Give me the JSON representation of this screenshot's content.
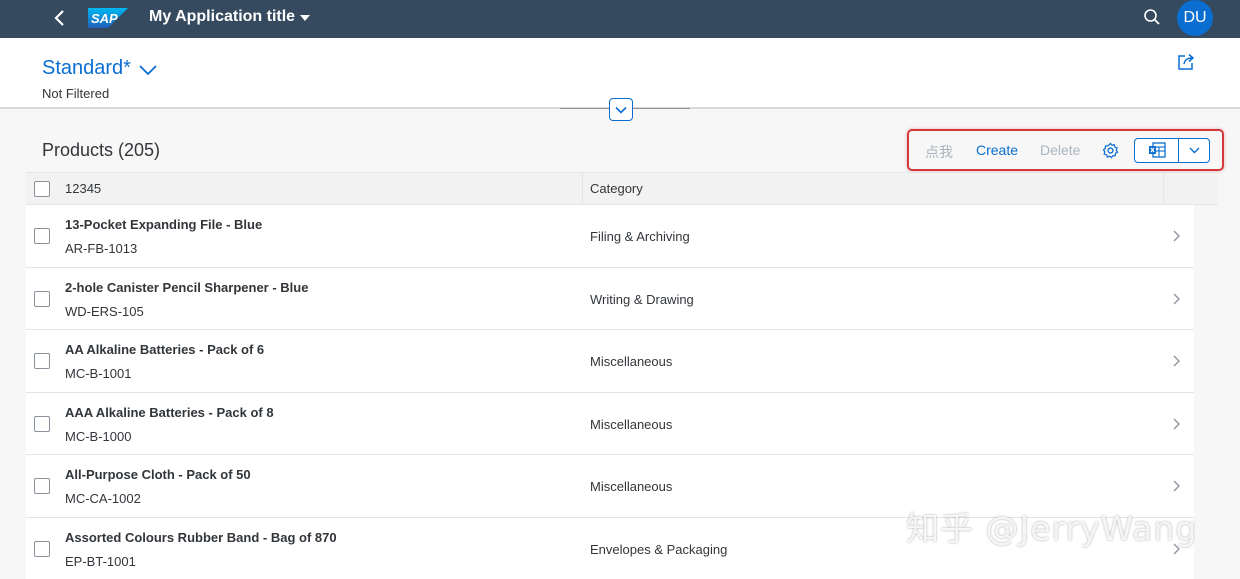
{
  "shell": {
    "app_title": "My Application title",
    "logo_text": "SAP",
    "avatar_initials": "DU"
  },
  "header": {
    "variant_name": "Standard*",
    "filter_status": "Not Filtered"
  },
  "table": {
    "title": "Products (205)",
    "toolbar": {
      "custom_label": "点我",
      "create_label": "Create",
      "delete_label": "Delete"
    },
    "columns": [
      "12345",
      "Category"
    ],
    "rows": [
      {
        "name": "13-Pocket Expanding File - Blue",
        "code": "AR-FB-1013",
        "category": "Filing & Archiving"
      },
      {
        "name": "2-hole Canister Pencil Sharpener - Blue",
        "code": "WD-ERS-105",
        "category": "Writing & Drawing"
      },
      {
        "name": "AA Alkaline Batteries - Pack of 6",
        "code": "MC-B-1001",
        "category": "Miscellaneous"
      },
      {
        "name": "AAA Alkaline Batteries - Pack of 8",
        "code": "MC-B-1000",
        "category": "Miscellaneous"
      },
      {
        "name": "All-Purpose Cloth - Pack of 50",
        "code": "MC-CA-1002",
        "category": "Miscellaneous"
      },
      {
        "name": "Assorted Colours Rubber Band - Bag of 870",
        "code": "EP-BT-1001",
        "category": "Envelopes & Packaging"
      }
    ]
  },
  "watermark": "知乎 @JerryWang",
  "colors": {
    "shell_bg": "#354a5f",
    "accent": "#0a6ed1",
    "highlight": "#d3393b"
  }
}
